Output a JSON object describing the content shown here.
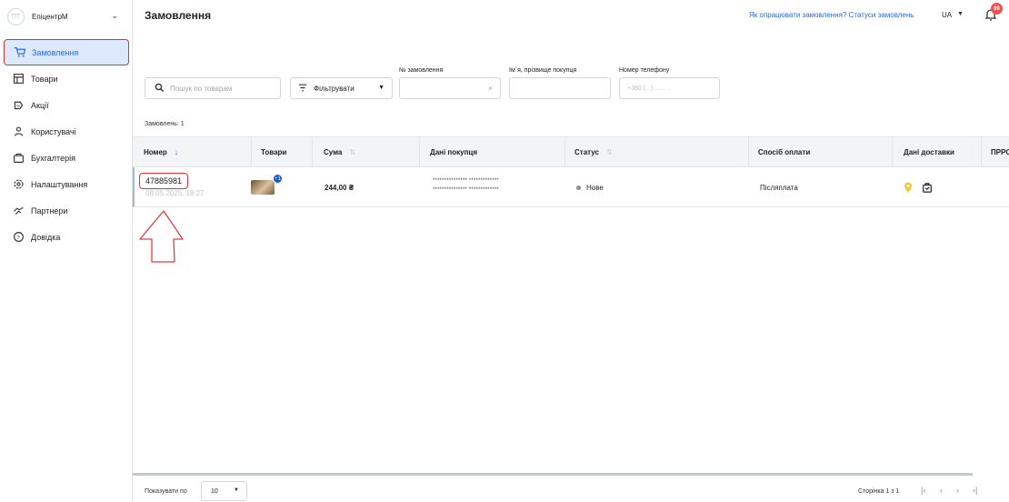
{
  "account": {
    "initials": "ПТ",
    "name": "ЕпіцентрМ"
  },
  "sidebar": {
    "items": [
      {
        "label": "Замовлення",
        "icon": "cart-icon",
        "active": true
      },
      {
        "label": "Товари",
        "icon": "box-icon"
      },
      {
        "label": "Акції",
        "icon": "tag-icon"
      },
      {
        "label": "Користувачі",
        "icon": "users-icon"
      },
      {
        "label": "Бухгалтерія",
        "icon": "accounting-icon"
      },
      {
        "label": "Налаштування",
        "icon": "gear-icon"
      },
      {
        "label": "Партнери",
        "icon": "handshake-icon"
      },
      {
        "label": "Довідка",
        "icon": "help-icon"
      }
    ]
  },
  "header": {
    "title": "Замовлення",
    "help_link": "Як опрацювати замовлення? Статуси замовлень",
    "language": "UA",
    "notifications": "99"
  },
  "filters": {
    "search_placeholder": "Пошук по товарам",
    "filter_label": "Фільтрувати",
    "order_number_label": "№ замовлення",
    "buyer_name_label": "Ім`я, прізвище покупця",
    "phone_label": "Номер телефону",
    "phone_placeholder": "+380 (...) ... .. .."
  },
  "orders_count": "Замовлень: 1",
  "table": {
    "headers": [
      "Номер",
      "Товари",
      "Сума",
      "Дані покупця",
      "Статус",
      "Спосіб оплати",
      "Дані доставки",
      "ПРРО"
    ],
    "rows": [
      {
        "number": "47885981",
        "date": "08.05.2025, 18:27",
        "extra_items": "+1",
        "sum": "244,00 ₴",
        "buyer_line1": "*************** *************",
        "buyer_line2": "*************** *************",
        "status": "Нове",
        "payment": "Післяплата"
      }
    ]
  },
  "footer": {
    "show_label": "Показувати по",
    "per_page": "10",
    "page_info": "Сторінка 1 з 1"
  },
  "colors": {
    "accent": "#2c6ad9",
    "highlight": "#dd3333",
    "badge": "#f0524f"
  }
}
